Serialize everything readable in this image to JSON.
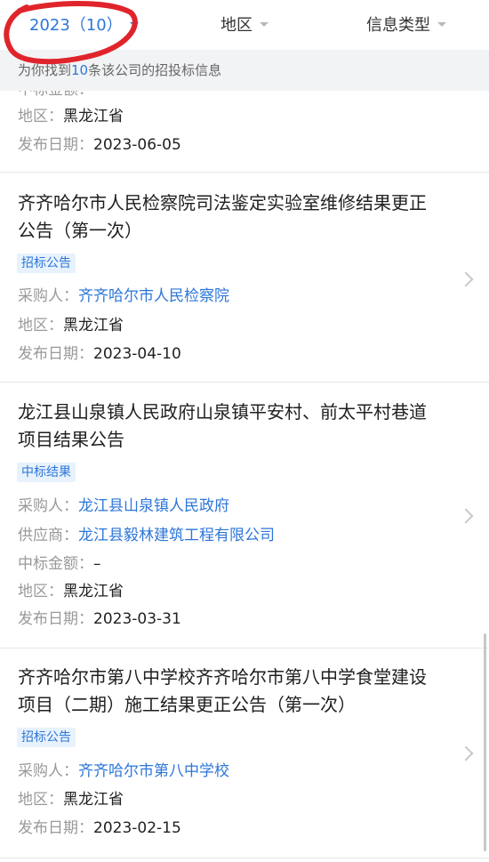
{
  "filters": {
    "year": "2023（10）",
    "region": "地区",
    "type": "信息类型"
  },
  "info": {
    "prefix": "为你找到",
    "count": "10",
    "suffix": "条该公司的招投标信息"
  },
  "partial_card": {
    "cut_text": "中标金额：",
    "region_label": "地区：",
    "region": "黑龙江省",
    "date_label": "发布日期：",
    "date": "2023-06-05"
  },
  "cards": [
    {
      "title": "齐齐哈尔市人民检察院司法鉴定实验室维修结果更正公告（第一次）",
      "tag": "招标公告",
      "buyer_label": "采购人：",
      "buyer": "齐齐哈尔市人民检察院",
      "region_label": "地区：",
      "region": "黑龙江省",
      "date_label": "发布日期：",
      "date": "2023-04-10"
    },
    {
      "title": "龙江县山泉镇人民政府山泉镇平安村、前太平村巷道项目结果公告",
      "tag": "中标结果",
      "buyer_label": "采购人：",
      "buyer": "龙江县山泉镇人民政府",
      "supplier_label": "供应商：",
      "supplier": "龙江县毅林建筑工程有限公司",
      "amount_label": "中标金额：",
      "amount": "–",
      "region_label": "地区：",
      "region": "黑龙江省",
      "date_label": "发布日期：",
      "date": "2023-03-31"
    },
    {
      "title": "齐齐哈尔市第八中学校齐齐哈尔市第八中学食堂建设项目（二期）施工结果更正公告（第一次）",
      "tag": "招标公告",
      "buyer_label": "采购人：",
      "buyer": "齐齐哈尔市第八中学校",
      "region_label": "地区：",
      "region": "黑龙江省",
      "date_label": "发布日期：",
      "date": "2023-02-15"
    }
  ],
  "colors": {
    "accent": "#2d76d9",
    "annotation": "#e0242b"
  },
  "icons": [
    "caret-down-icon",
    "chevron-right-icon"
  ]
}
